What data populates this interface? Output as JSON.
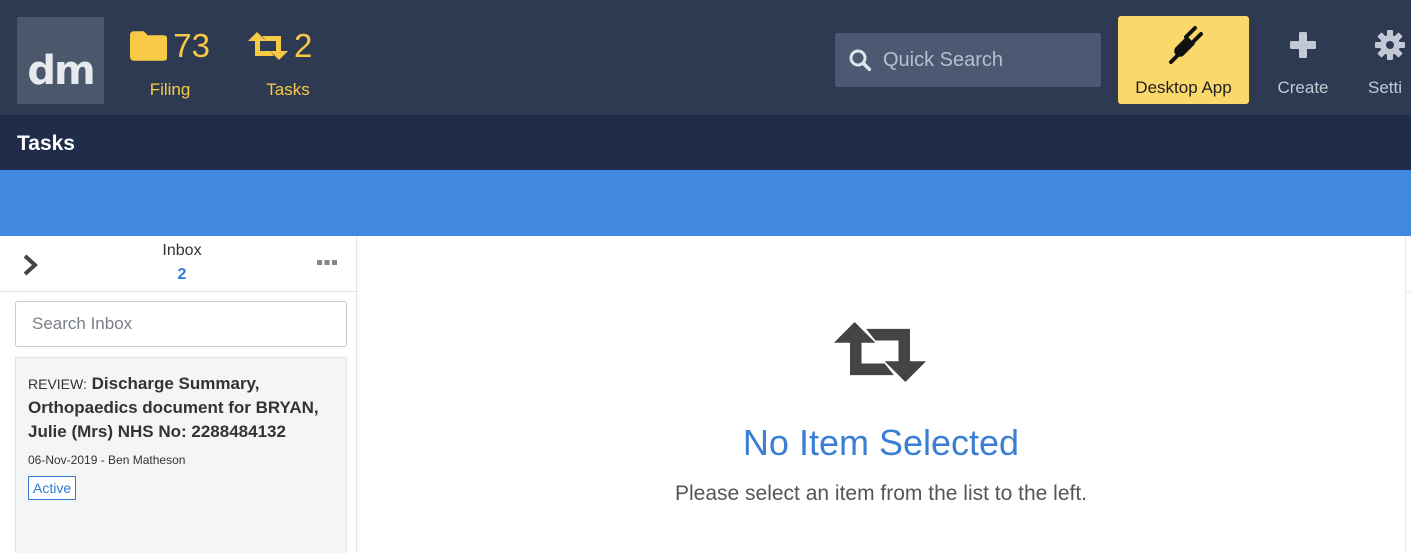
{
  "header": {
    "logo_text": "dm",
    "filing": {
      "count": "73",
      "label": "Filing"
    },
    "tasks": {
      "count": "2",
      "label": "Tasks"
    },
    "search": {
      "placeholder": "Quick Search"
    },
    "desktop_app_label": "Desktop App",
    "create_label": "Create",
    "settings_label": "Setti",
    "colors": {
      "topbar": "#2d3a52",
      "accent_yellow": "#f7c944",
      "desktop_button": "#fbd86a"
    }
  },
  "page": {
    "title": "Tasks",
    "colors": {
      "titlebar": "#1f2d4a",
      "bluebar": "#4287e0"
    }
  },
  "sidebar": {
    "inbox_title": "Inbox",
    "inbox_count": "2",
    "search_placeholder": "Search Inbox",
    "items": [
      {
        "prefix": "REVIEW:",
        "title": "Discharge Summary, Orthopaedics document for BRYAN, Julie (Mrs) NHS No: 2288484132",
        "meta": "06-Nov-2019 - Ben Matheson",
        "status": "Active"
      }
    ]
  },
  "main": {
    "icon": "retweet-icon",
    "title": "No Item Selected",
    "subtitle": "Please select an item from the list to the left."
  }
}
